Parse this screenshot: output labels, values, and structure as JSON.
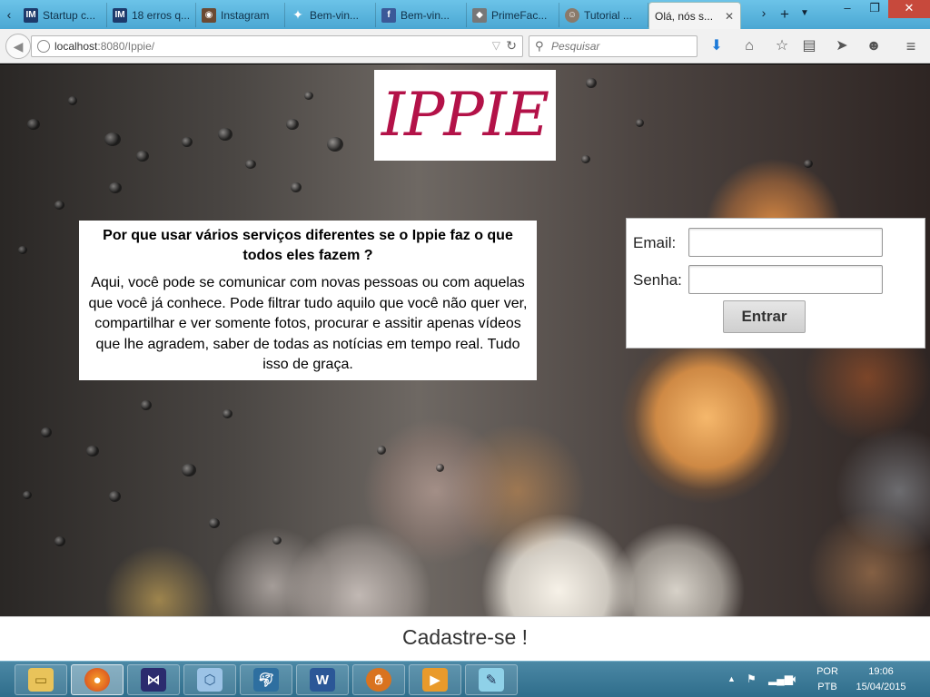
{
  "browser": {
    "tabs": [
      {
        "label": "Startup c...",
        "icon": "im-icon"
      },
      {
        "label": "18 erros q...",
        "icon": "im-icon"
      },
      {
        "label": "Instagram",
        "icon": "instagram-icon"
      },
      {
        "label": "Bem-vin...",
        "icon": "twitter-icon"
      },
      {
        "label": "Bem-vin...",
        "icon": "facebook-icon"
      },
      {
        "label": "PrimeFac...",
        "icon": "primefaces-icon"
      },
      {
        "label": "Tutorial ...",
        "icon": "tutorial-icon"
      },
      {
        "label": "Olá, nós s...",
        "icon": "none",
        "active": true
      }
    ],
    "url_host": "localhost",
    "url_rest": ":8080/Ippie/",
    "search_placeholder": "Pesquisar",
    "colors": {
      "tabbar": "#4aa7d3",
      "close_button": "#c7493c"
    }
  },
  "page": {
    "logo_text": "IPPIE",
    "info_heading": "Por que usar vários serviços diferentes se o Ippie faz o que todos eles fazem ?",
    "info_body": "Aqui, você pode se comunicar com novas pessoas ou com aquelas que você já conhece. Pode filtrar tudo aquilo que você não quer ver, compartilhar e ver somente fotos, procurar e assitir apenas vídeos que lhe agradem, saber de todas as notícias em tempo real. Tudo isso de graça.",
    "login": {
      "email_label": "Email:",
      "password_label": "Senha:",
      "submit_label": "Entrar"
    },
    "signup_label": "Cadastre-se !",
    "colors": {
      "logo": "#b31248"
    }
  },
  "taskbar": {
    "apps": [
      "file-explorer-icon",
      "firefox-icon",
      "visual-studio-icon",
      "virtualbox-icon",
      "mysql-workbench-icon",
      "word-icon",
      "glassfish-icon",
      "media-player-icon",
      "notepad-icon"
    ],
    "language": "POR",
    "keyboard": "PTB",
    "time": "19:06",
    "date": "15/04/2015"
  }
}
